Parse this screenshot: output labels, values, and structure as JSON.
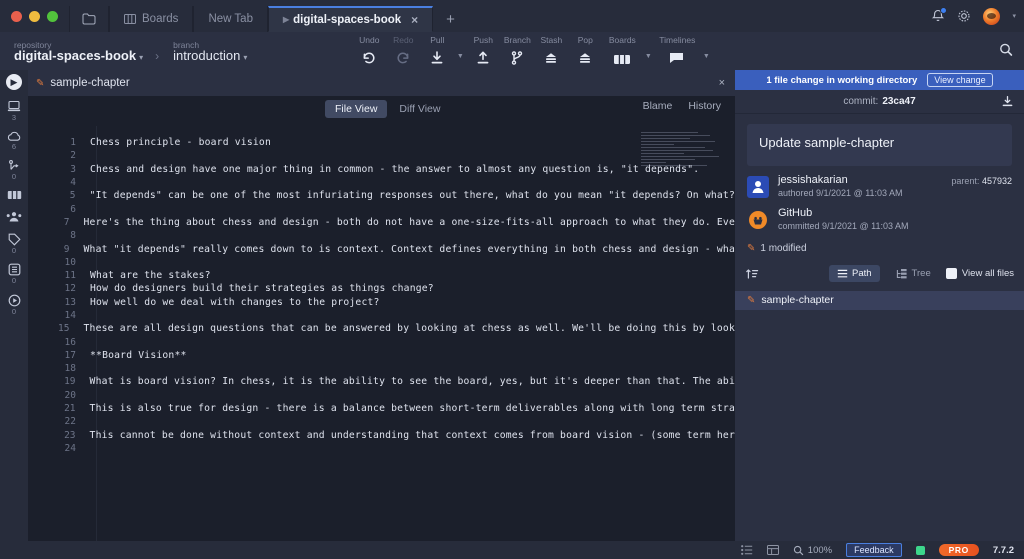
{
  "titlebar": {
    "tabs": [
      {
        "label": "",
        "icon": "folder-icon",
        "active": false
      },
      {
        "label": "Boards",
        "icon": "boards-icon",
        "active": false
      },
      {
        "label": "New Tab",
        "icon": "",
        "active": false
      },
      {
        "label": "digital-spaces-book",
        "icon": "chevron-right-icon",
        "active": true,
        "close": "×"
      }
    ],
    "new_tab_label": "+",
    "icons": {
      "bell": "bell-icon",
      "gear": "gear-icon",
      "avatar": "user-avatar",
      "caret": "▾"
    }
  },
  "toolbar": {
    "repository_label": "repository",
    "repository_name": "digital-spaces-book",
    "branch_label": "branch",
    "branch_name": "introduction",
    "separator": "›",
    "caret": "▾",
    "actions": [
      {
        "label": "Undo",
        "icon": "undo-icon",
        "dim": false,
        "caret": false
      },
      {
        "label": "Redo",
        "icon": "redo-icon",
        "dim": true,
        "caret": false
      },
      {
        "label": "Pull",
        "icon": "pull-icon",
        "dim": false,
        "caret": true
      },
      {
        "label": "Push",
        "icon": "push-icon",
        "dim": false,
        "caret": false
      },
      {
        "label": "Branch",
        "icon": "branch-icon",
        "dim": false,
        "caret": false
      },
      {
        "label": "Stash",
        "icon": "stash-icon",
        "dim": false,
        "caret": false
      },
      {
        "label": "Pop",
        "icon": "pop-icon",
        "dim": false,
        "caret": false
      },
      {
        "label": "Boards",
        "icon": "boards-icon",
        "dim": false,
        "caret": true
      },
      {
        "label": "Timelines",
        "icon": "timelines-icon",
        "dim": false,
        "caret": true
      }
    ],
    "search_icon": "search-icon"
  },
  "rail": {
    "toggle_icon": "expand-panel-icon",
    "items": [
      {
        "icon": "local-repo-icon",
        "count": "3"
      },
      {
        "icon": "cloud-icon",
        "count": "6"
      },
      {
        "icon": "pull-request-icon",
        "count": "0"
      },
      {
        "icon": "boards-icon",
        "count": ""
      },
      {
        "icon": "team-icon",
        "count": ""
      },
      {
        "icon": "tag-icon",
        "count": "0"
      },
      {
        "icon": "stash-icon",
        "count": "0"
      },
      {
        "icon": "timeline-icon",
        "count": "0"
      }
    ]
  },
  "editor": {
    "file_tab": {
      "label": "sample-chapter",
      "icon": "pencil-icon",
      "close": "×"
    },
    "view_tabs": [
      {
        "label": "File View",
        "active": true
      },
      {
        "label": "Diff View",
        "active": false
      }
    ],
    "right_links": [
      "Blame",
      "History"
    ],
    "lines": [
      {
        "n": "1",
        "t": "Chess principle - board vision"
      },
      {
        "n": "2",
        "t": ""
      },
      {
        "n": "3",
        "t": "Chess and design have one major thing in common - the answer to almost any question is, \"it depends\"."
      },
      {
        "n": "4",
        "t": ""
      },
      {
        "n": "5",
        "t": "\"It depends\" can be one of the most infuriating responses out there, what do you mean \"it depends? On what?"
      },
      {
        "n": "6",
        "t": ""
      },
      {
        "n": "7",
        "t": "Here's the thing about chess and design - both do not have a one-size-fits-all approach to what they do. Eve"
      },
      {
        "n": "8",
        "t": ""
      },
      {
        "n": "9",
        "t": "What \"it depends\" really comes down to is context. Context defines everything in both chess and design - wha"
      },
      {
        "n": "10",
        "t": ""
      },
      {
        "n": "11",
        "t": "What are the stakes?"
      },
      {
        "n": "12",
        "t": "How do designers build their strategies as things change?"
      },
      {
        "n": "13",
        "t": "How well do we deal with changes to the project?"
      },
      {
        "n": "14",
        "t": ""
      },
      {
        "n": "15",
        "t": "These are all design questions that can be answered by looking at chess as well. We'll be doing this by look"
      },
      {
        "n": "16",
        "t": ""
      },
      {
        "n": "17",
        "t": "**Board Vision**"
      },
      {
        "n": "18",
        "t": ""
      },
      {
        "n": "19",
        "t": "What is board vision? In chess, it is the ability to see the board, yes, but it's deeper than that. The abi"
      },
      {
        "n": "20",
        "t": ""
      },
      {
        "n": "21",
        "t": "This is also true for design - there is a balance between short-term deliverables along with long term stra"
      },
      {
        "n": "22",
        "t": ""
      },
      {
        "n": "23",
        "t": "This cannot be done without context and understanding that context comes from board vision - (some term her"
      },
      {
        "n": "24",
        "t": ""
      }
    ]
  },
  "right_panel": {
    "change_banner": "1 file change in working directory",
    "view_change_button": "View change",
    "commit_label": "commit:",
    "commit_hash": "23ca47",
    "download_icon": "download-icon",
    "commit_message": "Update sample-chapter",
    "authors": [
      {
        "name": "jessishakarian",
        "meta": "authored 9/1/2021 @ 11:03 AM",
        "avatar": "jessishakarian-avatar"
      },
      {
        "name": "GitHub",
        "meta": "committed 9/1/2021 @ 11:03 AM",
        "avatar": "github-avatar"
      }
    ],
    "parent_label": "parent:",
    "parent_hash": "457932",
    "modified_text": "1 modified",
    "sort_icon": "sort-icon",
    "segments": [
      {
        "label": "Path",
        "icon": "path-icon",
        "active": true
      },
      {
        "label": "Tree",
        "icon": "tree-icon",
        "active": false
      }
    ],
    "view_all_files": "View all files",
    "files": [
      {
        "name": "sample-chapter",
        "icon": "pencil-icon"
      }
    ]
  },
  "statusbar": {
    "list_icon": "list-view-icon",
    "grid_icon": "grid-view-icon",
    "zoom_icon": "magnifier-icon",
    "zoom_level": "100%",
    "feedback": "Feedback",
    "pro_badge": "PRO",
    "version": "7.7.2"
  },
  "colors": {
    "accent_blue": "#3a5fbd",
    "tab_active": "#2f3546",
    "panel_bg": "#2b3042",
    "editor_bg": "#1b1f2b",
    "pro_orange": "#e8521f"
  }
}
